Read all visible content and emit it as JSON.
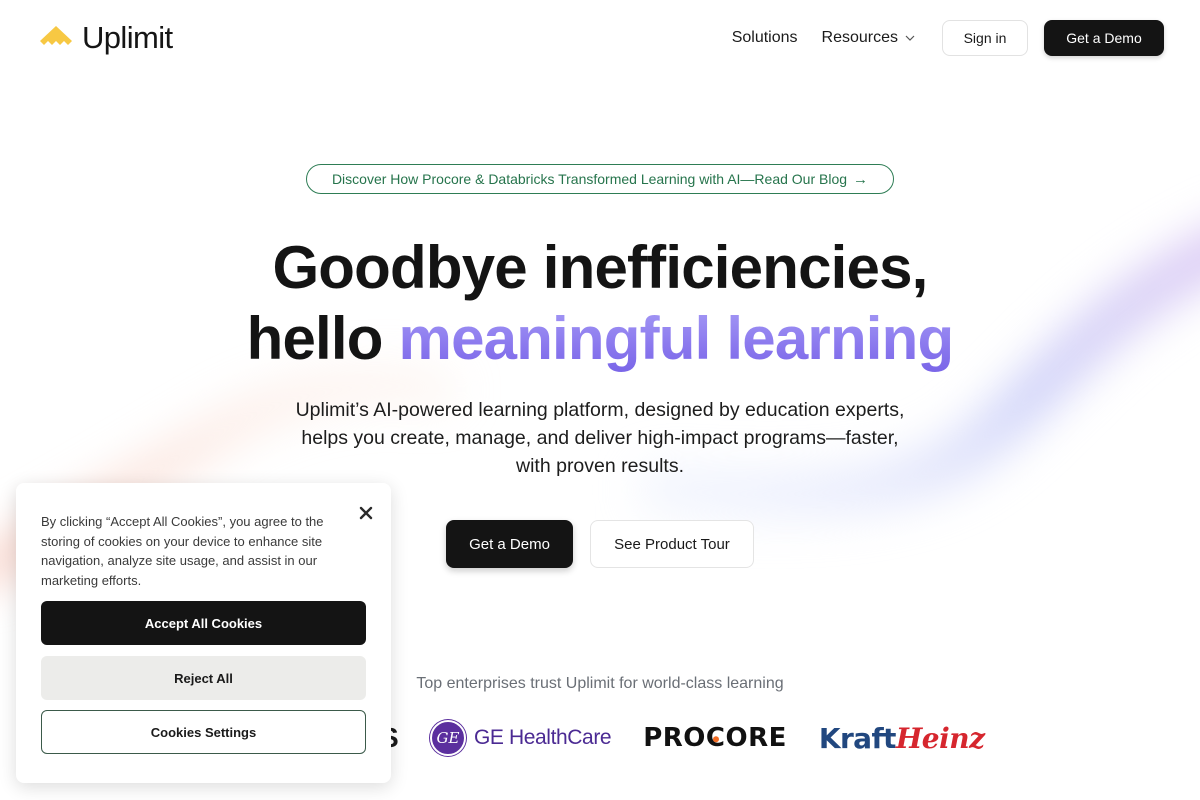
{
  "brand": {
    "name": "Uplimit",
    "logo_color": "#f7c843"
  },
  "nav": {
    "items": [
      {
        "label": "Solutions",
        "has_dropdown": false
      },
      {
        "label": "Resources",
        "has_dropdown": true
      }
    ],
    "sign_in_label": "Sign in",
    "demo_label": "Get a Demo"
  },
  "hero": {
    "announcement": "Discover How Procore & Databricks Transformed Learning with AI—Read Our Blog",
    "announcement_arrow": "→",
    "headline_line1": "Goodbye inefficiencies,",
    "headline_line2_plain": "hello ",
    "headline_line2_accent": "meaningful learning",
    "subhead_line1": "Uplimit’s AI-powered learning platform, designed by education experts,",
    "subhead_line2": "helps you create, manage, and deliver high-impact programs—faster,",
    "subhead_line3": "with proven results.",
    "cta_primary": "Get a Demo",
    "cta_secondary": "See Product Tour",
    "accent_color": "#8b79ee"
  },
  "trust": {
    "caption": "Top enterprises trust Uplimit for world-class learning",
    "logos": [
      {
        "name": "partial-logo",
        "text": "S"
      },
      {
        "name": "GE HealthCare",
        "badge": "GE",
        "text": "GE HealthCare"
      },
      {
        "name": "Procore",
        "text_pre": "PRO",
        "text_dot": "C",
        "text_post": "ORE"
      },
      {
        "name": "Kraft Heinz",
        "text_a": "Kraft",
        "text_b": "Heinz"
      }
    ]
  },
  "cookie_banner": {
    "text": "By clicking “Accept All Cookies”, you agree to the storing of cookies on your device to enhance site navigation, analyze site usage, and assist in our marketing efforts.",
    "accept_label": "Accept All Cookies",
    "reject_label": "Reject All",
    "settings_label": "Cookies Settings"
  }
}
